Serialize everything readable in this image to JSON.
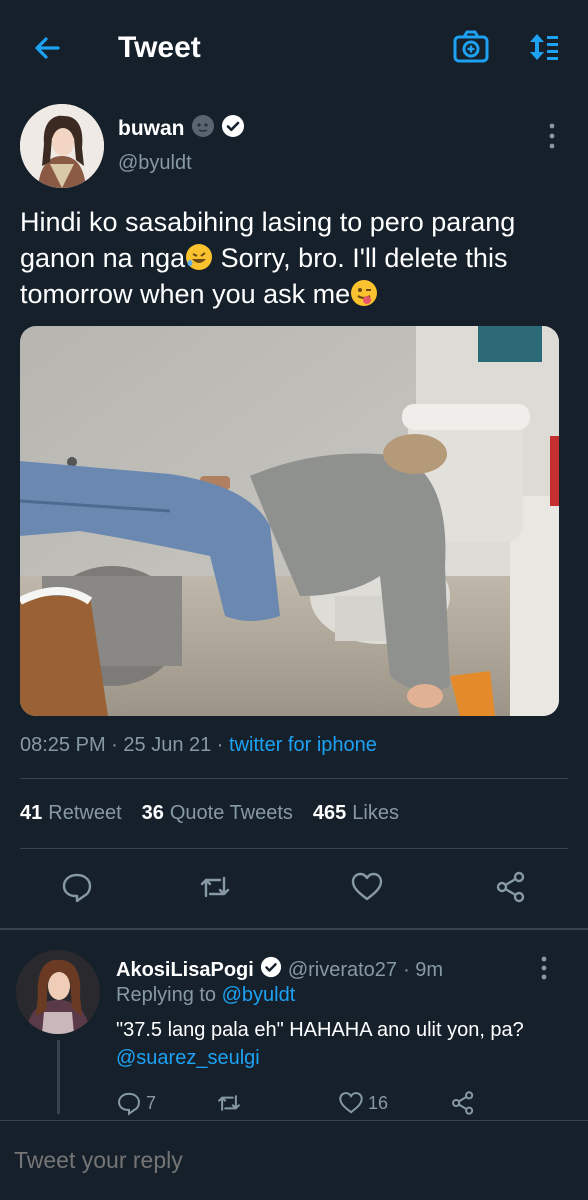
{
  "header": {
    "title": "Tweet"
  },
  "tweet": {
    "display_name": "buwan",
    "handle": "@byuldt",
    "text_line1": "Hindi ko sasabihing lasing to pero parang",
    "text_line2a": "ganon na nga",
    "text_line2b": " Sorry, bro. I'll delete this",
    "text_line3": "tomorrow when you ask me",
    "time": "08:25 PM",
    "date": "25 Jun 21",
    "source": "twitter for iphone",
    "retweets_count": "41",
    "retweets_label": "Retweet",
    "quotes_count": "36",
    "quotes_label": "Quote Tweets",
    "likes_count": "465",
    "likes_label": "Likes"
  },
  "reply": {
    "display_name": "AkosiLisaPogi",
    "handle": "@riverato27",
    "time": "· 9m",
    "replying_prefix": "Replying to ",
    "replying_to": "@byuldt",
    "text": "\"37.5 lang pala eh\" HAHAHA ano ulit yon, pa? ",
    "mention": "@suarez_seulgi",
    "reply_count": "7",
    "like_count": "16"
  },
  "compose": {
    "placeholder": "Tweet your reply"
  },
  "colors": {
    "background": "#15202b",
    "accent": "#1da1f2",
    "muted": "#8899a6",
    "divider": "#38444d"
  }
}
